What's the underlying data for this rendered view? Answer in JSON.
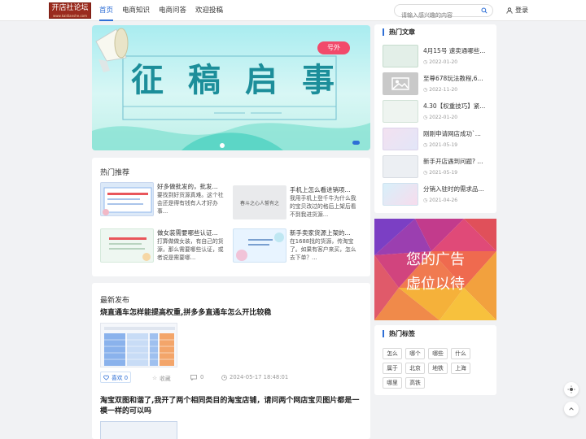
{
  "header": {
    "logo_text": "开店社论坛",
    "logo_sub": "www.kaidianshe.com",
    "nav": [
      "首页",
      "电商知识",
      "电商问答",
      "欢迎投稿"
    ],
    "search_placeholder": "请输入感兴趣的内容",
    "login_label": "登录"
  },
  "banner": {
    "badge": "号外",
    "headline": [
      "征",
      "稿",
      "启",
      "事"
    ]
  },
  "hot_recommend": {
    "title": "热门推荐",
    "items": [
      {
        "title": "好多做批发的，批发...",
        "desc": "要找到好货源真难。这个社会还是得有钱有人才好办事..."
      },
      {
        "title": "手机上怎么看进销项...",
        "desc": "我用手机上登千牛为什么我的宝贝改过的格后上架后看不到我进货源..."
      },
      {
        "title": "做女装需要哪些认证...",
        "desc": "打算做做女装，有自己的货源，那么需要哪些认证，或者说是需要哪..."
      },
      {
        "title": "新手卖家货源上架的...",
        "desc": "在1688找的货源，传淘宝了。如果有客户来买，怎么去下单？..."
      }
    ],
    "thumb_text": "春斗之心人誓有之"
  },
  "latest": {
    "title": "最新发布",
    "articles": [
      {
        "title": "烧直通车怎样能提高权重,拼多多直通车怎么开比较稳",
        "like": "喜欢 0",
        "fav": "收藏",
        "comments": "0",
        "time": "2024-05-17 18:48:01"
      },
      {
        "title": "淘宝双图和谐了,我开了两个相同类目的淘宝店铺，请问两个网店宝贝图片都是一模一样的可以吗"
      }
    ]
  },
  "hot_articles": {
    "title": "热门文章",
    "items": [
      {
        "title": "4月15号 速卖通哪些...",
        "date": "2022-01-20"
      },
      {
        "title": "至尊678玩法教程,6...",
        "date": "2022-11-20"
      },
      {
        "title": "4.30【权重技巧】紧...",
        "date": "2022-01-20"
      },
      {
        "title": "刚刚申请网店成功`...",
        "date": "2021-05-19"
      },
      {
        "title": "新手开店遇到问题? ...",
        "date": "2021-05-19"
      },
      {
        "title": "分销入驻时的需求品...",
        "date": "2021-04-26"
      }
    ]
  },
  "ad": {
    "line1": "您的广告",
    "line2": "虚位以待"
  },
  "hot_tags": {
    "title": "热门标签",
    "tags": [
      "怎么",
      "哪个",
      "哪些",
      "什么",
      "属于",
      "北京",
      "地铁",
      "上海",
      "哪里",
      "高铁"
    ]
  },
  "colors": {
    "accent": "#2f6fd6",
    "banner_title": "#1c8e9a",
    "badge": "#f24a6b"
  }
}
